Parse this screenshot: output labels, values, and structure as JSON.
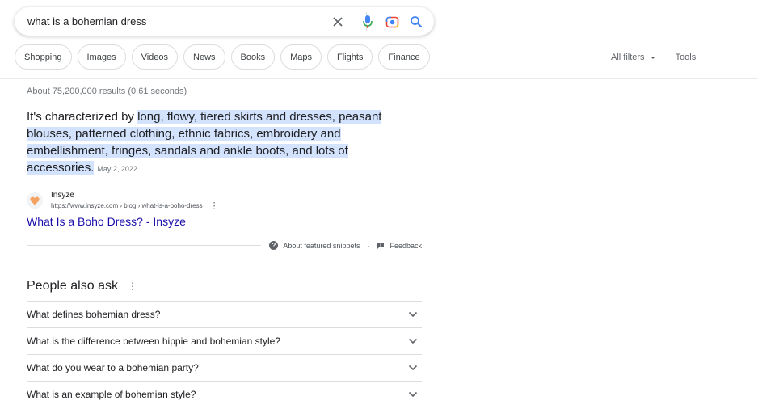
{
  "search": {
    "query": "what is a bohemian dress"
  },
  "chips": [
    "Shopping",
    "Images",
    "Videos",
    "News",
    "Books",
    "Maps",
    "Flights",
    "Finance"
  ],
  "filters": {
    "all_filters": "All filters",
    "tools": "Tools"
  },
  "results_stats": "About 75,200,000 results (0.61 seconds)",
  "featured_snippet": {
    "lead": "It's characterized by ",
    "highlight": "long, flowy, tiered skirts and dresses, peasant blouses, patterned clothing, ethnic fabrics, embroidery and embellishment, fringes, sandals and ankle boots, and lots of accessories.",
    "date": "May 2, 2022",
    "source_name": "Insyze",
    "source_url": "https://www.insyze.com › blog › what-is-a-boho-dress",
    "link_title": "What Is a Boho Dress? - Insyze",
    "about_label": "About featured snippets",
    "feedback_label": "Feedback",
    "bullet": "·"
  },
  "people_also_ask": {
    "title": "People also ask",
    "questions": [
      "What defines bohemian dress?",
      "What is the difference between hippie and bohemian style?",
      "What do you wear to a bohemian party?",
      "What is an example of bohemian style?"
    ]
  },
  "icons": {
    "clear": "close-icon",
    "voice": "microphone-icon",
    "lens": "camera-icon",
    "search": "search-icon",
    "favicon": "heart-icon",
    "more": "more-vert-icon",
    "expand": "chevron-down-icon"
  },
  "colors": {
    "link": "#1a0dab",
    "highlight": "#d3e3fd",
    "search_blue": "#4285f4"
  }
}
